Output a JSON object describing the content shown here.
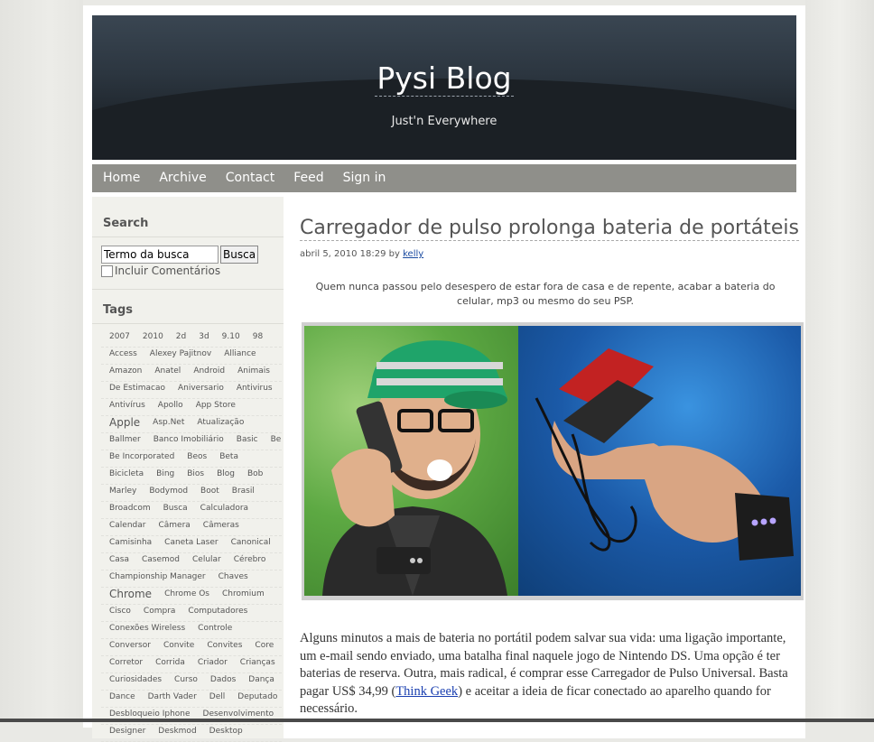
{
  "header": {
    "title": "Pysi Blog",
    "subtitle": "Just'n Everywhere"
  },
  "nav": {
    "items": [
      "Home",
      "Archive",
      "Contact",
      "Feed",
      "Sign in"
    ]
  },
  "sidebar": {
    "search_title": "Search",
    "search_value": "Termo da busca",
    "search_button": "Busca",
    "include_comments": "Incluir Comentários",
    "tags_title": "Tags"
  },
  "tags": [
    [
      "2007",
      "2010",
      "2d",
      "3d",
      "9.10",
      "98"
    ],
    [
      "Access",
      "Alexey Pajitnov",
      "Alliance"
    ],
    [
      "Amazon",
      "Anatel",
      "Android",
      "Animais"
    ],
    [
      "De Estimacao",
      "Aniversario",
      "Antivirus"
    ],
    [
      "Antivírus",
      "Apollo",
      "App Store"
    ],
    [
      "Apple",
      "Asp.Net",
      "Atualização"
    ],
    [
      "Ballmer",
      "Banco Imobiliário",
      "Basic",
      "Be"
    ],
    [
      "Be Incorporated",
      "Beos",
      "Beta"
    ],
    [
      "Bicicleta",
      "Bing",
      "Bios",
      "Blog",
      "Bob"
    ],
    [
      "Marley",
      "Bodymod",
      "Boot",
      "Brasil"
    ],
    [
      "Broadcom",
      "Busca",
      "Calculadora"
    ],
    [
      "Calendar",
      "Câmera",
      "Câmeras"
    ],
    [
      "Camisinha",
      "Caneta Laser",
      "Canonical"
    ],
    [
      "Casa",
      "Casemod",
      "Celular",
      "Cérebro"
    ],
    [
      "Championship Manager",
      "Chaves"
    ],
    [
      "Chrome",
      "Chrome Os",
      "Chromium"
    ],
    [
      "Cisco",
      "Compra",
      "Computadores"
    ],
    [
      "Conexões Wireless",
      "Controle"
    ],
    [
      "Conversor",
      "Convite",
      "Convites",
      "Core"
    ],
    [
      "Corretor",
      "Corrida",
      "Criador",
      "Crianças"
    ],
    [
      "Curiosidades",
      "Curso",
      "Dados",
      "Dança"
    ],
    [
      "Dance",
      "Darth Vader",
      "Dell",
      "Deputado"
    ],
    [
      "Desbloqueio Iphone",
      "Desenvolvimento"
    ],
    [
      "Designer",
      "Deskmod",
      "Desktop"
    ]
  ],
  "big_tags": [
    "Apple",
    "Chrome"
  ],
  "post": {
    "title": "Carregador de pulso prolonga bateria de portáteis",
    "date": "abril 5, 2010 18:29 by ",
    "author": "kelly",
    "intro": "Quem nunca passou pelo desespero de estar fora de casa e de repente, acabar a bateria do celular,  mp3 ou mesmo do seu PSP.",
    "body_before_link": "Alguns minutos a mais de bateria no portátil podem salvar sua vida: uma ligação importante, um e-mail sendo enviado, uma batalha final naquele jogo de Nintendo DS. Uma opção é ter baterias de reserva. Outra, mais radical, é comprar esse Carregador de Pulso Universal. Basta pagar US$ 34,99 (",
    "link": "Think Geek",
    "body_after_link": ") e aceitar a ideia de ficar conectado ao aparelho quando for necessário."
  }
}
